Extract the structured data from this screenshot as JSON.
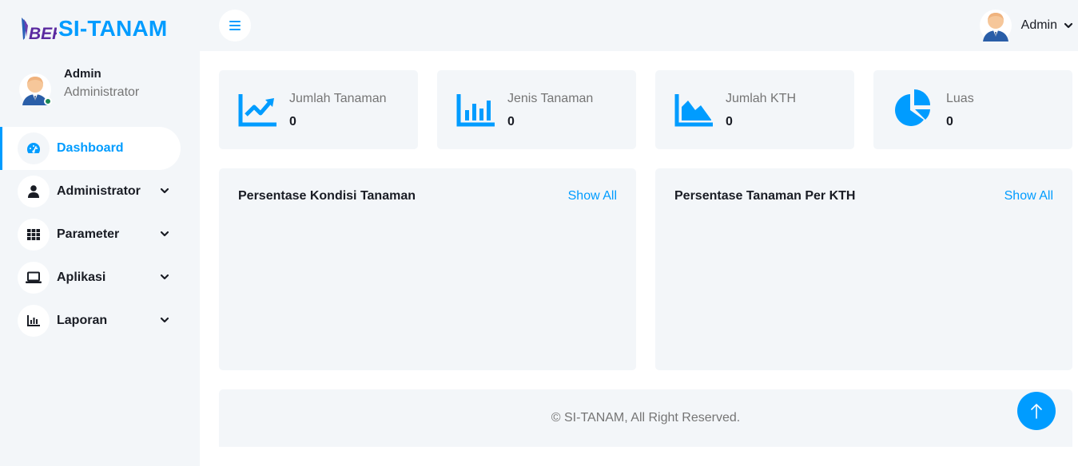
{
  "brand": {
    "logo_text": "BEK",
    "name": "SI-TANAM",
    "accent_color": "#009CFF"
  },
  "sidebar": {
    "profile": {
      "name": "Admin",
      "role": "Administrator",
      "status": "online"
    },
    "items": [
      {
        "label": "Dashboard",
        "icon": "gauge-icon",
        "active": true,
        "has_submenu": false
      },
      {
        "label": "Administrator",
        "icon": "user-icon",
        "active": false,
        "has_submenu": true
      },
      {
        "label": "Parameter",
        "icon": "grid-icon",
        "active": false,
        "has_submenu": true
      },
      {
        "label": "Aplikasi",
        "icon": "laptop-icon",
        "active": false,
        "has_submenu": true
      },
      {
        "label": "Laporan",
        "icon": "chart-bar-icon",
        "active": false,
        "has_submenu": true
      }
    ]
  },
  "topbar": {
    "toggle_icon": "menu-icon",
    "user_name": "Admin"
  },
  "stats": [
    {
      "label": "Jumlah Tanaman",
      "value": "0",
      "icon": "chart-line-icon"
    },
    {
      "label": "Jenis Tanaman",
      "value": "0",
      "icon": "chart-bar-icon"
    },
    {
      "label": "Jumlah KTH",
      "value": "0",
      "icon": "chart-area-icon"
    },
    {
      "label": "Luas",
      "value": "0",
      "icon": "chart-pie-icon"
    }
  ],
  "panels": [
    {
      "title": "Persentase Kondisi Tanaman",
      "link": "Show All"
    },
    {
      "title": "Persentase Tanaman Per KTH",
      "link": "Show All"
    }
  ],
  "footer": {
    "text": "© SI-TANAM, All Right Reserved."
  },
  "back_to_top_icon": "arrow-up-icon"
}
